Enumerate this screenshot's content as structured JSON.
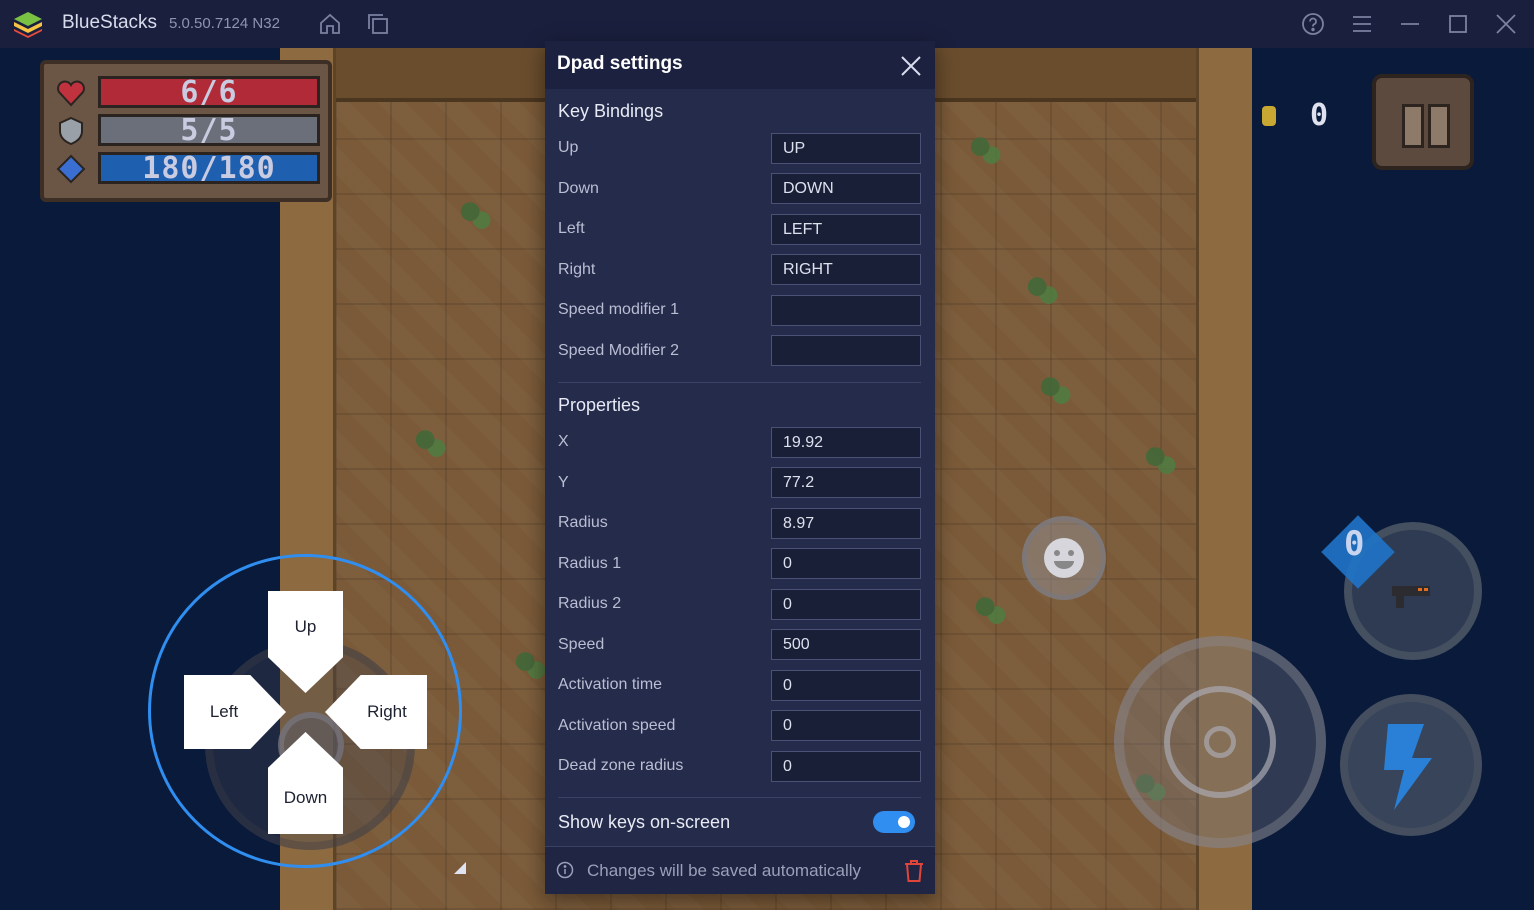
{
  "titlebar": {
    "app_name": "BlueStacks",
    "version": "5.0.50.7124 N32",
    "icons": [
      "home-icon",
      "multi-instance-icon",
      "help-icon",
      "menu-icon",
      "minimize-icon",
      "maximize-icon",
      "close-icon"
    ]
  },
  "hud": {
    "health": "6/6",
    "armor": "5/5",
    "energy": "180/180",
    "coins": "0",
    "weapon_ammo": "0"
  },
  "dpad": {
    "up": "Up",
    "down": "Down",
    "left": "Left",
    "right": "Right"
  },
  "panel": {
    "title": "Dpad settings",
    "key_bindings_title": "Key Bindings",
    "key_bindings": [
      {
        "label": "Up",
        "value": "UP"
      },
      {
        "label": "Down",
        "value": "DOWN"
      },
      {
        "label": "Left",
        "value": "LEFT"
      },
      {
        "label": "Right",
        "value": "RIGHT"
      },
      {
        "label": "Speed modifier 1",
        "value": ""
      },
      {
        "label": "Speed Modifier 2",
        "value": ""
      }
    ],
    "properties_title": "Properties",
    "properties": [
      {
        "label": "X",
        "value": "19.92"
      },
      {
        "label": "Y",
        "value": "77.2"
      },
      {
        "label": "Radius",
        "value": "8.97"
      },
      {
        "label": "Radius 1",
        "value": "0"
      },
      {
        "label": "Radius 2",
        "value": "0"
      },
      {
        "label": "Speed",
        "value": "500"
      },
      {
        "label": "Activation time",
        "value": "0"
      },
      {
        "label": "Activation speed",
        "value": "0"
      },
      {
        "label": "Dead zone radius",
        "value": "0"
      }
    ],
    "show_keys_label": "Show keys on-screen",
    "show_keys_enabled": true,
    "footer_text": "Changes will be saved automatically"
  },
  "colors": {
    "accent": "#2f8ef0",
    "panel_bg": "#252b4a",
    "titlebar_bg": "#1a1f3d",
    "health_bar": "#b02a37",
    "armor_bar": "#6a6f7a",
    "energy_bar": "#1f5fb0",
    "delete": "#e0453a"
  }
}
